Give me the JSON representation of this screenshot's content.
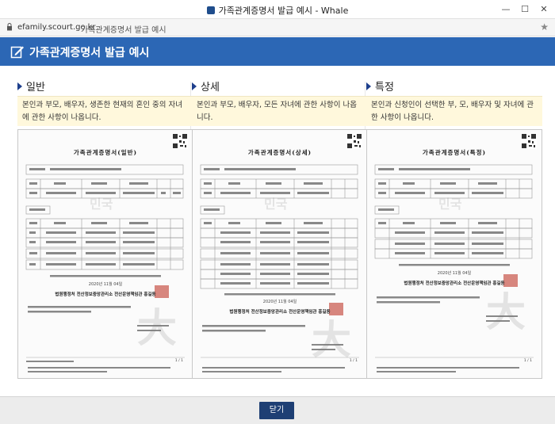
{
  "window": {
    "title": "가족관계증명서 발급 예시 - Whale",
    "minimize": "—",
    "maximize": "☐",
    "close": "✕"
  },
  "address_bar": {
    "domain": "efamily.scourt.go.kr",
    "page_title": "가족관계증명서 발급 예시"
  },
  "header": {
    "title": "가족관계증명서 발급 예시"
  },
  "columns": [
    {
      "heading": "일반",
      "description": "본인과 부모, 배우자, 생존한 현재의 혼인 중의 자녀에 관한 사항이 나옵니다.",
      "doc_title": "가족관계증명서(일반)",
      "date": "2020년 11월 04일",
      "issuer": "법원행정처 전산정보중앙관리소 전산운영책임관 홍길동",
      "page": "1 / 1"
    },
    {
      "heading": "상세",
      "description": "본인과 부모, 배우자, 모든 자녀에 관한 사항이 나옵니다.",
      "doc_title": "가족관계증명서(상세)",
      "date": "2020년 11월 04일",
      "issuer": "법원행정처 전산정보중앙관리소 전산운영책임관 홍길동",
      "page": "1 / 1"
    },
    {
      "heading": "특정",
      "description": "본인과 신청인이 선택한 부, 모, 배우자 및 자녀에 관한 사항이 나옵니다.",
      "doc_title": "가족관계증명서(특정)",
      "date": "2020년 11월 04일",
      "issuer": "법원행정처 전산정보중앙관리소 전산운영책임관 홍길동",
      "page": "1 / 1"
    }
  ],
  "footer": {
    "close_label": "닫기"
  },
  "colors": {
    "header_bg": "#2c67b5",
    "desc_bg": "#fff8dc",
    "button_bg": "#1e3f74",
    "arrow": "#1e3f8c"
  }
}
